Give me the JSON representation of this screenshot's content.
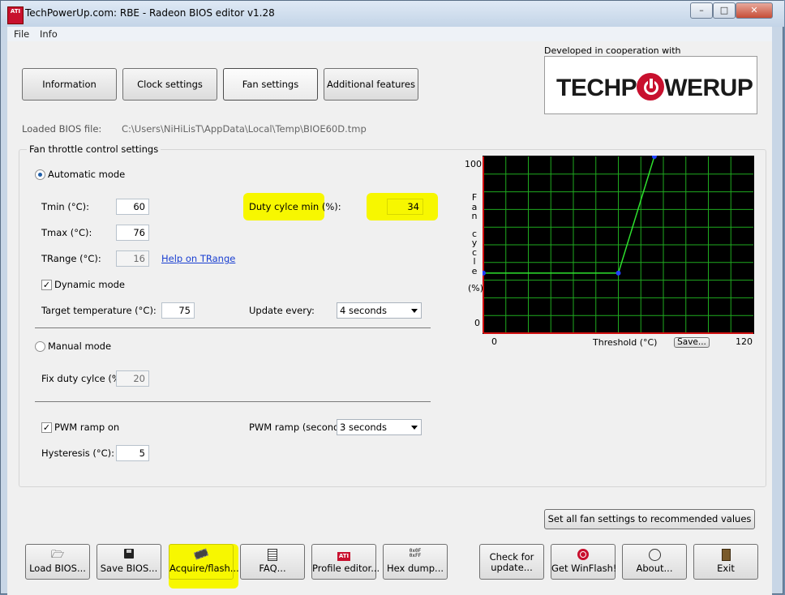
{
  "window": {
    "title": "TechPowerUp.com: RBE - Radeon BIOS editor v1.28",
    "app_icon_text": "ATI",
    "minimize": "–",
    "maximize": "□",
    "close": "✕"
  },
  "menu": [
    "File",
    "Info"
  ],
  "tabs": [
    {
      "label": "Information",
      "active": false
    },
    {
      "label": "Clock settings",
      "active": false
    },
    {
      "label": "Fan settings",
      "active": true
    },
    {
      "label": "Additional features",
      "active": false
    }
  ],
  "cooperation": {
    "caption": "Developed in cooperation with",
    "logo_left": "TECHP",
    "logo_right": "WERUP"
  },
  "loaded_bios": {
    "label": "Loaded BIOS file:",
    "path": "C:\\Users\\NiHiLisT\\AppData\\Local\\Temp\\BIOE60D.tmp"
  },
  "fan": {
    "group_title": "Fan throttle control settings",
    "automatic_mode_label": "Automatic mode",
    "tmin_label": "Tmin (°C):",
    "tmin_value": "60",
    "tmax_label": "Tmax (°C):",
    "tmax_value": "76",
    "trange_label": "TRange (°C):",
    "trange_value": "16",
    "help_trange": "Help on TRange",
    "duty_min_label": "Duty cylce min (%):",
    "duty_min_value": "34",
    "dynamic_mode_label": "Dynamic mode",
    "target_temp_label": "Target temperature (°C):",
    "target_temp_value": "75",
    "update_every_label": "Update every:",
    "update_every_value": "4 seconds",
    "manual_mode_label": "Manual mode",
    "fix_duty_label": "Fix duty cylce (%):",
    "fix_duty_value": "20",
    "pwm_ramp_on_label": "PWM ramp on",
    "pwm_ramp_label": "PWM ramp (seconds):",
    "pwm_ramp_value": "3 seconds",
    "hysteresis_label": "Hysteresis (°C):",
    "hysteresis_value": "5",
    "recommended_button": "Set all fan settings to recommended values",
    "check_mark": "✓"
  },
  "chart_data": {
    "type": "line",
    "ylabel_chars": [
      "F",
      "a",
      "n",
      "c",
      "y",
      "c",
      "l",
      "e",
      "(%)"
    ],
    "xlabel": "Threshold (°C)",
    "x_tick_labels": [
      "0",
      "120"
    ],
    "y_tick_labels": [
      "100",
      "0"
    ],
    "xlim": [
      0,
      120
    ],
    "ylim": [
      0,
      100
    ],
    "grid": true,
    "save_button": "Save...",
    "series": [
      {
        "x": [
          0,
          60,
          76
        ],
        "y": [
          34,
          34,
          100
        ]
      }
    ],
    "colors": {
      "background": "#000000",
      "grid": "#1faa1f",
      "axis": "#d01010",
      "line": "#2ee02e",
      "points": "#2040ff"
    }
  },
  "bottom_buttons": [
    {
      "label": "Load BIOS...",
      "icon": "folder-icon"
    },
    {
      "label": "Save BIOS...",
      "icon": "floppy-icon"
    },
    {
      "label": "Acquire/flash...",
      "icon": "chip-icon"
    },
    {
      "label": "FAQ...",
      "icon": "document-icon"
    },
    {
      "label": "Profile editor...",
      "icon": "ati-icon"
    },
    {
      "label": "Hex dump...",
      "icon": "hex-icon"
    },
    {
      "label": "Check for update...",
      "icon": ""
    },
    {
      "label": "Get WinFlash!",
      "icon": "power-icon"
    },
    {
      "label": "About...",
      "icon": "clock-icon"
    },
    {
      "label": "Exit",
      "icon": "exit-door-icon"
    }
  ]
}
